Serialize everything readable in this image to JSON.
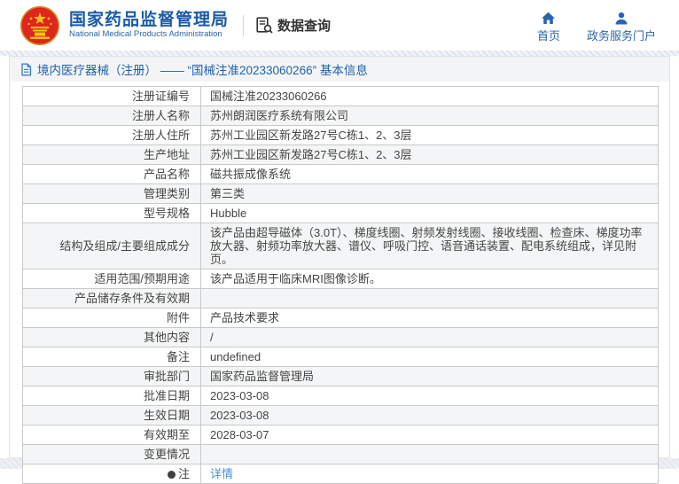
{
  "header": {
    "title": "国家药品监督管理局",
    "subtitle": "National Medical Products Administration",
    "section_label": "数据查询",
    "nav": [
      {
        "label": "首页",
        "icon": "home-icon"
      },
      {
        "label": "政务服务门户",
        "icon": "user-icon"
      }
    ]
  },
  "breadcrumb": {
    "text": "境内医疗器械（注册） —— “国械注准20233060266” 基本信息"
  },
  "table": {
    "rows": [
      {
        "label": "注册证编号",
        "value": "国械注准20233060266"
      },
      {
        "label": "注册人名称",
        "value": "苏州朗润医疗系统有限公司"
      },
      {
        "label": "注册人住所",
        "value": "苏州工业园区新发路27号C栋1、2、3层"
      },
      {
        "label": "生产地址",
        "value": "苏州工业园区新发路27号C栋1、2、3层"
      },
      {
        "label": "产品名称",
        "value": "磁共振成像系统"
      },
      {
        "label": "管理类别",
        "value": "第三类"
      },
      {
        "label": "型号规格",
        "value": "Hubble"
      },
      {
        "label": "结构及组成/主要组成成分",
        "value": "该产品由超导磁体（3.0T）、梯度线圈、射频发射线圈、接收线圈、检查床、梯度功率放大器、射频功率放大器、谱仪、呼吸门控、语音通话装置、配电系统组成，详见附页。"
      },
      {
        "label": "适用范围/预期用途",
        "value": "该产品适用于临床MRI图像诊断。"
      },
      {
        "label": "产品储存条件及有效期",
        "value": ""
      },
      {
        "label": "附件",
        "value": "产品技术要求"
      },
      {
        "label": "其他内容",
        "value": "/"
      },
      {
        "label": "备注",
        "value": "undefined"
      },
      {
        "label": "审批部门",
        "value": "国家药品监督管理局"
      },
      {
        "label": "批准日期",
        "value": "2023-03-08"
      },
      {
        "label": "生效日期",
        "value": "2023-03-08"
      },
      {
        "label": "有效期至",
        "value": "2028-03-07"
      },
      {
        "label": "变更情况",
        "value": ""
      },
      {
        "label": "注",
        "icon": "note-icon",
        "value": "详情",
        "link": true
      }
    ]
  },
  "colors": {
    "brand_blue": "#1a5aa6",
    "nav_blue": "#2a65b0",
    "breadcrumb_blue": "#2260ad",
    "link_blue": "#4a90d6",
    "emblem_red": "#e0251c",
    "emblem_gold": "#f5c01e",
    "row_stripe": "#f4f5f6",
    "table_border": "#c9c9c9"
  }
}
